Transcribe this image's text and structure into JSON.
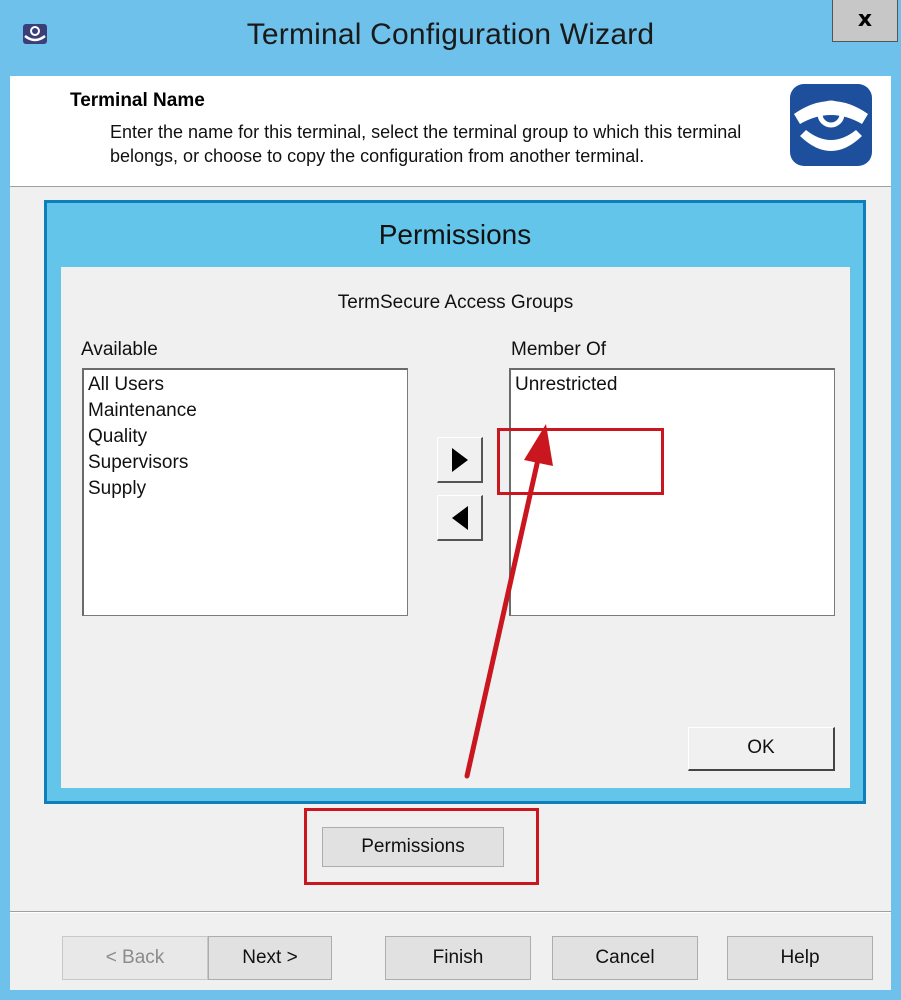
{
  "window": {
    "title": "Terminal Configuration Wizard",
    "close_label": "x"
  },
  "header": {
    "title": "Terminal Name",
    "description": "Enter the name for this terminal, select the terminal group to which this terminal belongs, or choose to copy the configuration from another terminal."
  },
  "permissions_dialog": {
    "title": "Permissions",
    "group_label": "TermSecure Access Groups",
    "available_label": "Available",
    "member_label": "Member Of",
    "available_items": [
      "All Users",
      "Maintenance",
      "Quality",
      "Supervisors",
      "Supply"
    ],
    "member_items": [
      "Unrestricted"
    ],
    "ok_label": "OK"
  },
  "permissions_button_label": "Permissions",
  "nav": {
    "back_label": "< Back",
    "next_label": "Next >",
    "finish_label": "Finish",
    "cancel_label": "Cancel",
    "help_label": "Help"
  },
  "colors": {
    "accent": "#6dc1ea",
    "dialog_border": "#0f7fb9",
    "annotation": "#c9161f"
  }
}
